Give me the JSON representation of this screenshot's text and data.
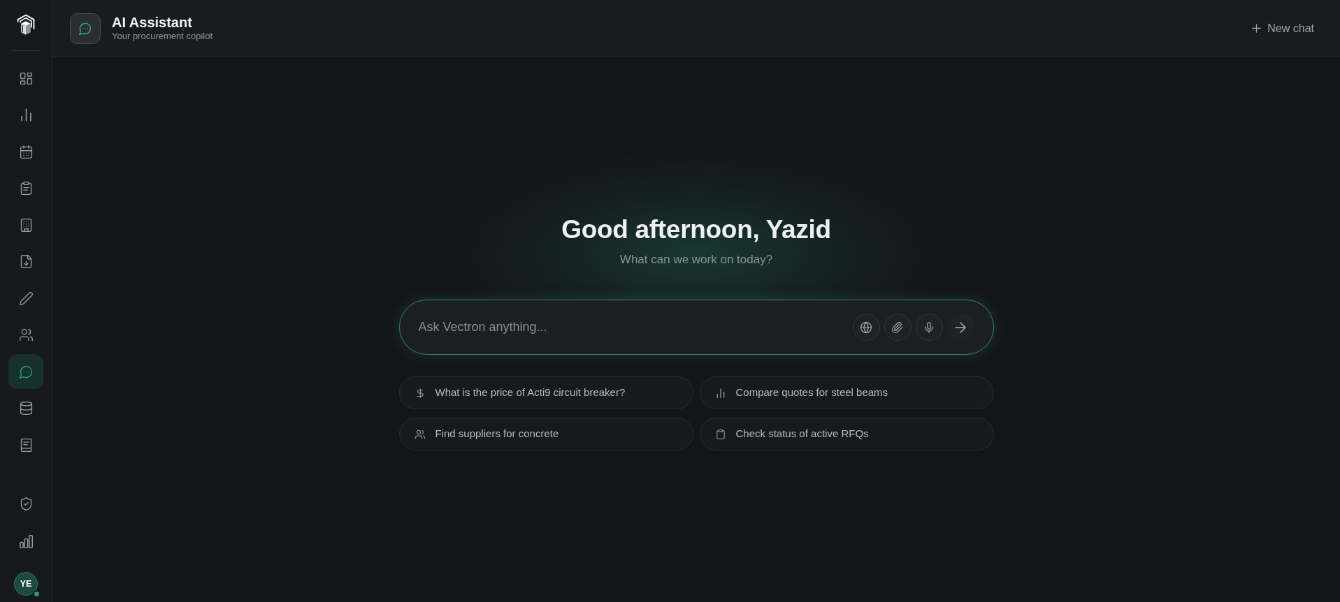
{
  "sidebar": {
    "nav_items": [
      {
        "selected": false
      },
      {
        "selected": false
      },
      {
        "selected": false
      },
      {
        "selected": false
      },
      {
        "selected": false
      },
      {
        "selected": false
      },
      {
        "selected": false
      },
      {
        "selected": false
      },
      {
        "selected": true
      },
      {
        "selected": false
      },
      {
        "selected": false
      }
    ],
    "bottom_items": [
      {
        "selected": false
      },
      {
        "selected": false
      }
    ],
    "user": {
      "initials": "YE",
      "online": true
    }
  },
  "header": {
    "title": "AI Assistant",
    "subtitle": "Your procurement copilot",
    "new_chat": "New chat"
  },
  "hero": {
    "greeting": "Good afternoon, Yazid",
    "prompt": "What can we work on today?"
  },
  "composer": {
    "placeholder": "Ask Vectron anything...",
    "focused": true
  },
  "suggestions": [
    {
      "text": "What is the price of Acti9 circuit breaker?"
    },
    {
      "text": "Compare quotes for steel beams"
    },
    {
      "text": "Find suppliers for concrete"
    },
    {
      "text": "Check status of active RFQs"
    }
  ]
}
